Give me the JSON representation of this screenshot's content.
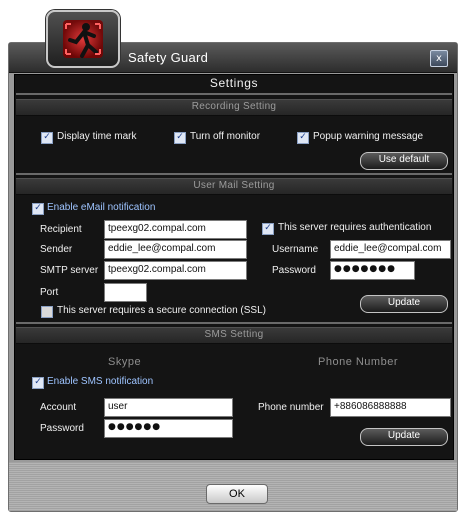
{
  "window": {
    "title": "Safety Guard",
    "close_glyph": "x",
    "logo_icon": "running-person-red-icon"
  },
  "dialog": {
    "title": "Settings"
  },
  "recording": {
    "header": "Recording Setting",
    "display_time_mark": {
      "label": "Display time mark",
      "checked": true
    },
    "turn_off_monitor": {
      "label": "Turn off monitor",
      "checked": true
    },
    "popup_warning": {
      "label": "Popup warning message",
      "checked": true
    },
    "use_default_label": "Use default"
  },
  "mail": {
    "header": "User Mail Setting",
    "enable": {
      "label": "Enable eMail notification",
      "checked": true
    },
    "recipient_label": "Recipient",
    "recipient_value": "tpeexg02.compal.com",
    "sender_label": "Sender",
    "sender_value": "eddie_lee@compal.com",
    "smtp_label": "SMTP server",
    "smtp_value": "tpeexg02.compal.com",
    "port_label": "Port",
    "port_value": "",
    "auth": {
      "label": "This server requires authentication",
      "checked": true
    },
    "username_label": "Username",
    "username_value": "eddie_lee@compal.com",
    "password_label": "Password",
    "password_value": "●●●●●●●",
    "ssl": {
      "label": "This server requires a secure connection (SSL)",
      "checked": false
    },
    "update_label": "Update"
  },
  "sms": {
    "header": "SMS Setting",
    "skype_title": "Skype",
    "phone_title": "Phone Number",
    "enable": {
      "label": "Enable SMS notification",
      "checked": true
    },
    "account_label": "Account",
    "account_value": "user",
    "password_label": "Password",
    "password_value": "●●●●●●",
    "phone_label": "Phone number",
    "phone_value": "+886086888888",
    "update_label": "Update"
  },
  "footer": {
    "ok_label": "OK"
  },
  "colors": {
    "panel": "#141414",
    "link_blue": "#9ec4ff",
    "check_blue": "#1e3e8a"
  }
}
